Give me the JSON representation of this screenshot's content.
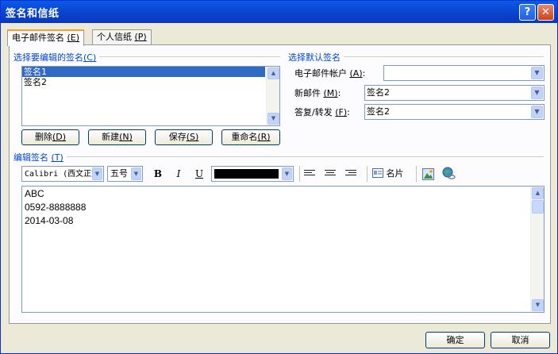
{
  "window": {
    "title": "签名和信纸",
    "help_glyph": "?",
    "close_glyph": "✕"
  },
  "tabs": [
    {
      "label": "电子邮件签名",
      "hotkey": "(E)",
      "active": true
    },
    {
      "label": "个人信纸",
      "hotkey": "(P)",
      "active": false
    }
  ],
  "edit_select": {
    "group_label": "选择要编辑的签名",
    "group_hotkey": "(C)",
    "signatures": [
      "签名1",
      "签名2"
    ],
    "selected_index": 0
  },
  "actions": [
    {
      "label": "删除",
      "hotkey": "(D)"
    },
    {
      "label": "新建",
      "hotkey": "(N)"
    },
    {
      "label": "保存",
      "hotkey": "(S)"
    },
    {
      "label": "重命名",
      "hotkey": "(R)"
    }
  ],
  "defaults": {
    "group_label": "选择默认签名",
    "account": {
      "label": "电子邮件帐户",
      "hotkey": "(A)",
      "suffix": ":",
      "value": ""
    },
    "new_messages": {
      "label": "新邮件",
      "hotkey": "(M)",
      "suffix": ":",
      "value": "签名2"
    },
    "replies": {
      "label": "答复/转发",
      "hotkey": "(F)",
      "suffix": ":",
      "value": "签名2"
    }
  },
  "editor": {
    "group_label": "编辑签名",
    "group_hotkey": "(T)",
    "font_name": "Calibri (西文正文)",
    "font_size": "五号",
    "bold": "B",
    "italic": "I",
    "underline": "U",
    "font_color": "#000000",
    "business_card_label": "名片",
    "icons": [
      "bold-icon",
      "italic-icon",
      "underline-icon",
      "align-left-icon",
      "align-center-icon",
      "align-right-icon",
      "business-card-icon",
      "insert-picture-icon",
      "insert-hyperlink-icon"
    ],
    "lines": [
      "ABC",
      "0592-8888888",
      "2014-03-08"
    ]
  },
  "footer": {
    "ok": "确定",
    "cancel": "取消"
  },
  "colors": {
    "title_bar": "#0a48d5",
    "group_label": "#0046d5",
    "selection": "#316ac5",
    "dialog_bg": "#ece9d8"
  }
}
